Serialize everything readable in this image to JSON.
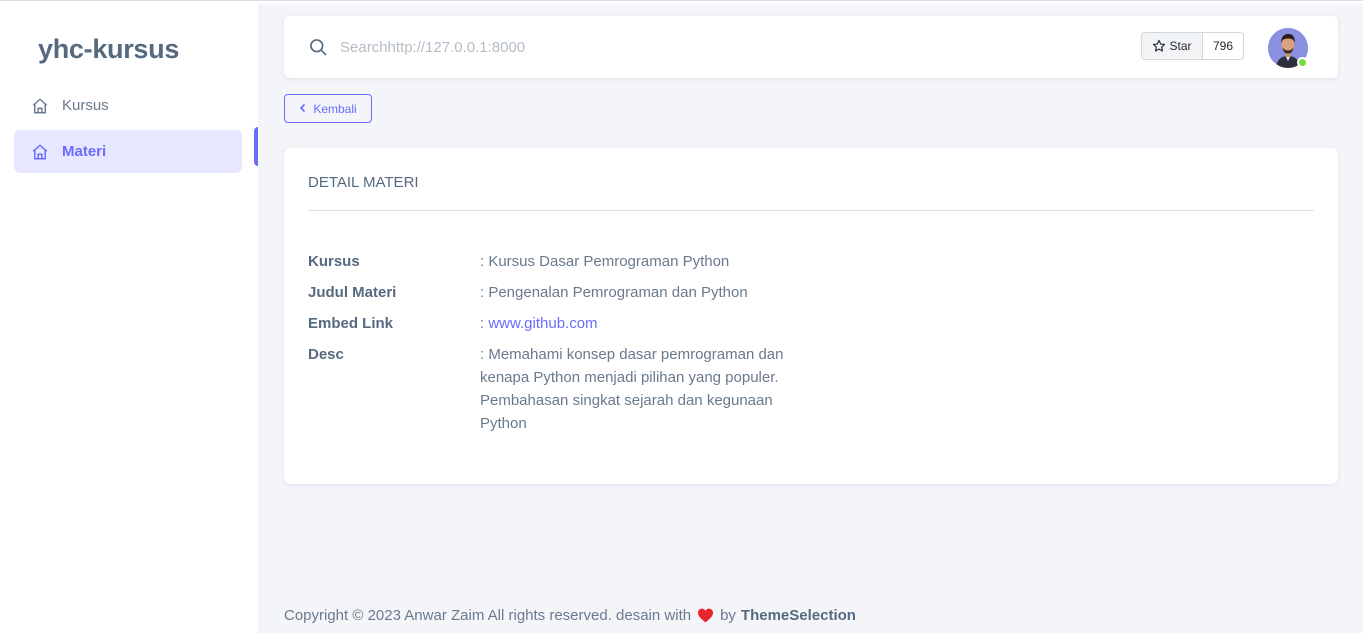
{
  "sidebar": {
    "brand": "yhc-kursus",
    "items": [
      {
        "label": "Kursus",
        "icon": "home-icon",
        "active": false
      },
      {
        "label": "Materi",
        "icon": "home-icon",
        "active": true
      }
    ]
  },
  "navbar": {
    "search_placeholder": "Searchhttp://127.0.0.1:8000",
    "star_label": "Star",
    "star_count": "796",
    "avatar": "user-avatar",
    "online_color": "#71dd37"
  },
  "back_button": {
    "label": "Kembali"
  },
  "detail": {
    "title": "DETAIL MATERI",
    "rows": [
      {
        "label": "Kursus",
        "value": ": Kursus Dasar Pemrograman Python"
      },
      {
        "label": "Judul Materi",
        "value": ": Pengenalan Pemrograman dan Python"
      },
      {
        "label": "Embed Link",
        "prefix": ": ",
        "link": "www.github.com"
      },
      {
        "label": "Desc",
        "value": ": Memahami konsep dasar pemrograman dan kenapa Python menjadi pilihan yang populer. Pembahasan singkat sejarah dan kegunaan Python"
      }
    ]
  },
  "footer": {
    "text": "Copyright © 2023 Anwar Zaim All rights reserved. desain with",
    "by": "by",
    "brand": "ThemeSelection"
  },
  "colors": {
    "accent": "#696cff",
    "heart": "#e8252d"
  }
}
